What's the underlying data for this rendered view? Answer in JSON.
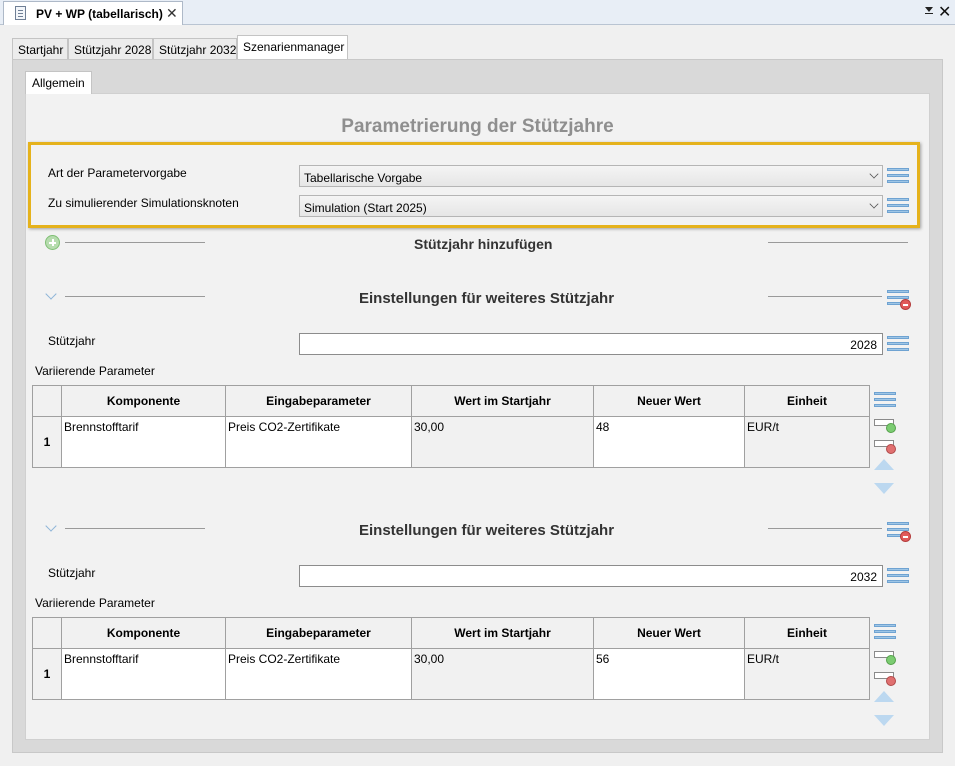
{
  "editor": {
    "tab_title": "PV + WP (tabellarisch)",
    "close_symbol": "✕",
    "view_close_symbol": "✕"
  },
  "main_tabs": [
    "Startjahr",
    "Stützjahr 2028",
    "Stützjahr 2032",
    "Szenarienmanager"
  ],
  "active_main_tab": "Szenarienmanager",
  "sub_tab": "Allgemein",
  "page_title": "Parametrierung der Stützjahre",
  "settings": {
    "param_label": "Art der Parametervorgabe",
    "param_value": "Tabellarische Vorgabe",
    "node_label": "Zu simulierender Simulationsknoten",
    "node_value": "Simulation (Start 2025)"
  },
  "add_support_year": "Stützjahr hinzufügen",
  "table_headers": [
    "Komponente",
    "Eingabeparameter",
    "Wert im Startjahr",
    "Neuer Wert",
    "Einheit"
  ],
  "sections": [
    {
      "title": "Einstellungen für weiteres Stützjahr",
      "year_label": "Stützjahr",
      "year_value": "2028",
      "params_label": "Variierende Parameter",
      "rows": [
        {
          "num": "1",
          "komponente": "Brennstofftarif",
          "eingabe": "Preis CO2-Zertifikate",
          "start": "30,00",
          "neu": "48",
          "einheit": "EUR/t"
        }
      ]
    },
    {
      "title": "Einstellungen für weiteres Stützjahr",
      "year_label": "Stützjahr",
      "year_value": "2032",
      "params_label": "Variierende Parameter",
      "rows": [
        {
          "num": "1",
          "komponente": "Brennstofftarif",
          "eingabe": "Preis CO2-Zertifikate",
          "start": "30,00",
          "neu": "56",
          "einheit": "EUR/t"
        }
      ]
    }
  ],
  "colors": {
    "highlight": "#e5b21c",
    "title_gray": "#8f8f8f",
    "icon_blue": "#9fc6e6"
  }
}
